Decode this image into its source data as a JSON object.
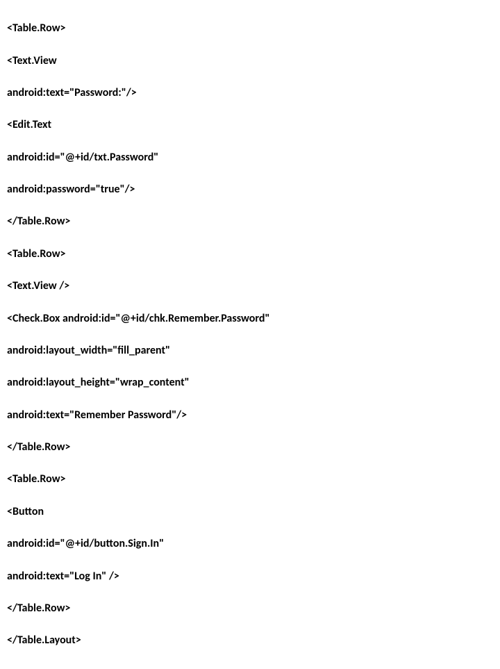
{
  "lines": [
    "<Table.Row>",
    "<Text.View",
    "android:text=\"Password:\"/>",
    "<Edit.Text",
    "android:id=\"@+id/txt.Password\"",
    "android:password=\"true\"/>",
    "</Table.Row>",
    "<Table.Row>",
    "<Text.View />",
    "<Check.Box android:id=\"@+id/chk.Remember.Password\"",
    "android:layout_width=\"fill_parent\"",
    "android:layout_height=\"wrap_content\"",
    "android:text=\"Remember Password\"/>",
    "</Table.Row>",
    "<Table.Row>",
    "<Button",
    "android:id=\"@+id/button.Sign.In\"",
    "android:text=\"Log In\" />",
    "</Table.Row>",
    "</Table.Layout>"
  ]
}
